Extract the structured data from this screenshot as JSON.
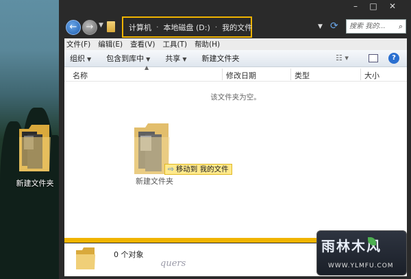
{
  "desktop": {
    "folder_label": "新建文件夹"
  },
  "window": {
    "controls": {
      "minimize": "–",
      "maximize": "□",
      "close": "✕"
    },
    "breadcrumb": [
      "计算机",
      "本地磁盘 (D:)",
      "我的文件"
    ],
    "breadcrumb_sep": "·",
    "search_placeholder": "搜索 我的...",
    "menu": [
      "文件(F)",
      "编辑(E)",
      "查看(V)",
      "工具(T)",
      "帮助(H)"
    ],
    "toolbar": [
      "组织",
      "包含到库中",
      "共享",
      "新建文件夹"
    ],
    "columns": [
      "名称",
      "修改日期",
      "类型",
      "大小"
    ],
    "empty_message": "该文件夹为空。",
    "drag": {
      "tooltip": "移动到 我的文件",
      "folder_label": "新建文件夹"
    },
    "status": {
      "count": "0 个对象",
      "signature": "quers"
    }
  },
  "watermark": {
    "title": "雨林木风",
    "url": "WWW.YLMFU.COM"
  },
  "colors": {
    "highlight": "#f0b400",
    "window_frame": "#2a2a2a",
    "tooltip_bg": "#ffe98c"
  }
}
